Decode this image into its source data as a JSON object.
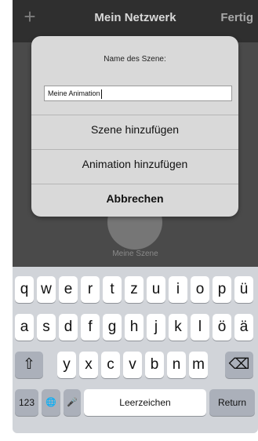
{
  "nav": {
    "add_glyph": "+",
    "title": "Mein Netzwerk",
    "done_label": "Fertig"
  },
  "scene": {
    "label": "Meine Szene"
  },
  "dialog": {
    "title": "Name des Szene:",
    "input_value": "Meine Animation",
    "add_scene_label": "Szene hinzufügen",
    "add_animation_label": "Animation hinzufügen",
    "cancel_label": "Abbrechen"
  },
  "keyboard": {
    "row1": [
      "q",
      "w",
      "e",
      "r",
      "t",
      "z",
      "u",
      "i",
      "o",
      "p",
      "ü"
    ],
    "row2": [
      "a",
      "s",
      "d",
      "f",
      "g",
      "h",
      "j",
      "k",
      "l",
      "ö",
      "ä"
    ],
    "row3": [
      "y",
      "x",
      "c",
      "v",
      "b",
      "n",
      "m"
    ],
    "shift_glyph": "⇧",
    "delete_glyph": "⌫",
    "numbers_label": "123",
    "globe_glyph": "🌐",
    "mic_glyph": "🎤",
    "space_label": "Leerzeichen",
    "return_label": "Return"
  }
}
